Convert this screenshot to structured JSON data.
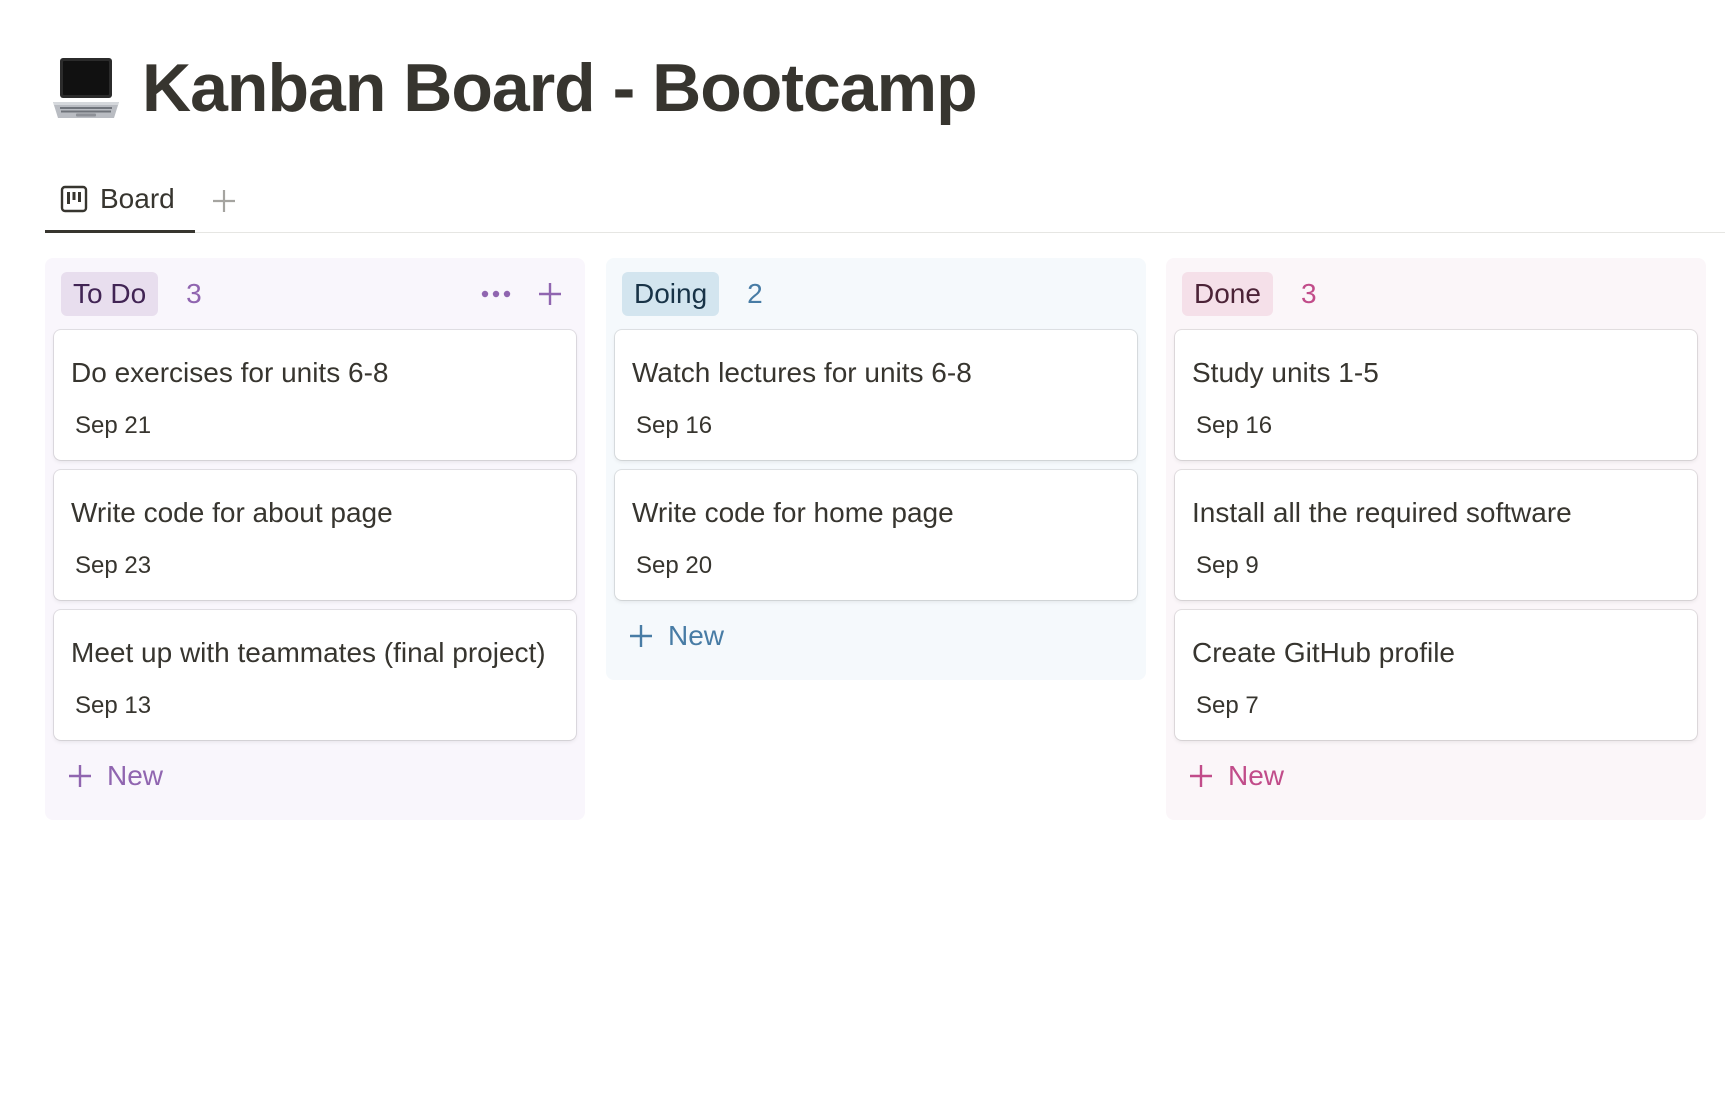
{
  "page": {
    "title": "Kanban Board - Bootcamp",
    "icon": "laptop-icon"
  },
  "tabs": [
    {
      "label": "Board",
      "icon": "board-view-icon",
      "active": true
    }
  ],
  "columns": [
    {
      "name": "To Do",
      "count": "3",
      "colors": {
        "badge_bg": "#e8deee",
        "badge_text": "#412454",
        "count": "#9065b0",
        "accent": "#9065b0"
      },
      "cards": [
        {
          "title": "Do exercises for units 6-8",
          "date": "Sep 21"
        },
        {
          "title": "Write code for about page",
          "date": "Sep 23"
        },
        {
          "title": "Meet up with teammates (final project)",
          "date": "Sep 13"
        }
      ],
      "new_label": "New"
    },
    {
      "name": "Doing",
      "count": "2",
      "colors": {
        "badge_bg": "#d3e5ef",
        "badge_text": "#183347",
        "count": "#487ca5",
        "accent": "#487ca5"
      },
      "cards": [
        {
          "title": "Watch lectures for units 6-8",
          "date": "Sep 16"
        },
        {
          "title": "Write code for home page",
          "date": "Sep 20"
        }
      ],
      "new_label": "New"
    },
    {
      "name": "Done",
      "count": "3",
      "colors": {
        "badge_bg": "#f5e0e9",
        "badge_text": "#4c2337",
        "count": "#c14c8a",
        "accent": "#c14c8a"
      },
      "cards": [
        {
          "title": "Study units 1-5",
          "date": "Sep 16"
        },
        {
          "title": "Install all the required software",
          "date": "Sep 9"
        },
        {
          "title": "Create GitHub profile",
          "date": "Sep 7"
        }
      ],
      "new_label": "New"
    }
  ]
}
